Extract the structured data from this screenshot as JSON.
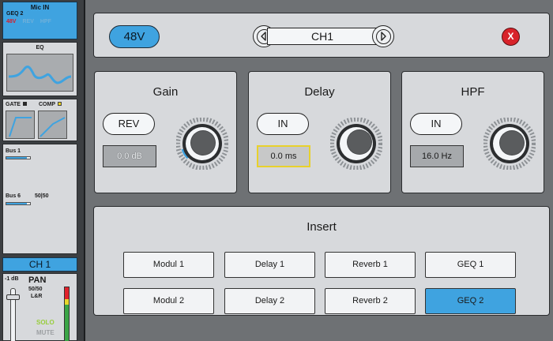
{
  "strip": {
    "input": {
      "title": "Mic IN",
      "geq": "GEQ 2",
      "flags": {
        "phantom": "48V",
        "rev": "REV",
        "hpf": "HPF"
      }
    },
    "eq": {
      "label": "EQ"
    },
    "dynamics": {
      "gate_label": "GATE",
      "comp_label": "COMP"
    },
    "buses": [
      {
        "label": "Bus 1",
        "level": 0.85
      },
      {
        "label": "Bus 6",
        "pan": "50|50",
        "level": 0.85
      }
    ],
    "channel_label": "CH 1",
    "bottom": {
      "fader_db": "-1 dB",
      "pan_label": "PAN",
      "pan_value": "50/50",
      "assign": "L&R",
      "solo": "SOLO",
      "mute": "MUTE"
    }
  },
  "header": {
    "phantom_label": "48V",
    "channel_name": "CH1",
    "close_label": "X"
  },
  "gain": {
    "title": "Gain",
    "button": "REV",
    "value": "0.0 dB"
  },
  "delay": {
    "title": "Delay",
    "button": "IN",
    "value": "0.0 ms"
  },
  "hpf": {
    "title": "HPF",
    "button": "IN",
    "value": "16.0 Hz"
  },
  "insert": {
    "title": "Insert",
    "slots": [
      "Modul 1",
      "Delay 1",
      "Reverb 1",
      "GEQ 1",
      "Modul 2",
      "Delay 2",
      "Reverb 2",
      "GEQ 2"
    ],
    "active_slot": "GEQ 2"
  },
  "colors": {
    "accent": "#3fa3e0",
    "close": "#d8232a",
    "phantom_flag": "#d61e2a",
    "solo": "#98cd3c",
    "highlight_border": "#e8d12c"
  },
  "icons": [
    "left-arrow-icon",
    "right-arrow-icon",
    "close-icon",
    "gate-curve-icon",
    "comp-curve-icon",
    "eq-curve-icon",
    "knob-icon"
  ]
}
